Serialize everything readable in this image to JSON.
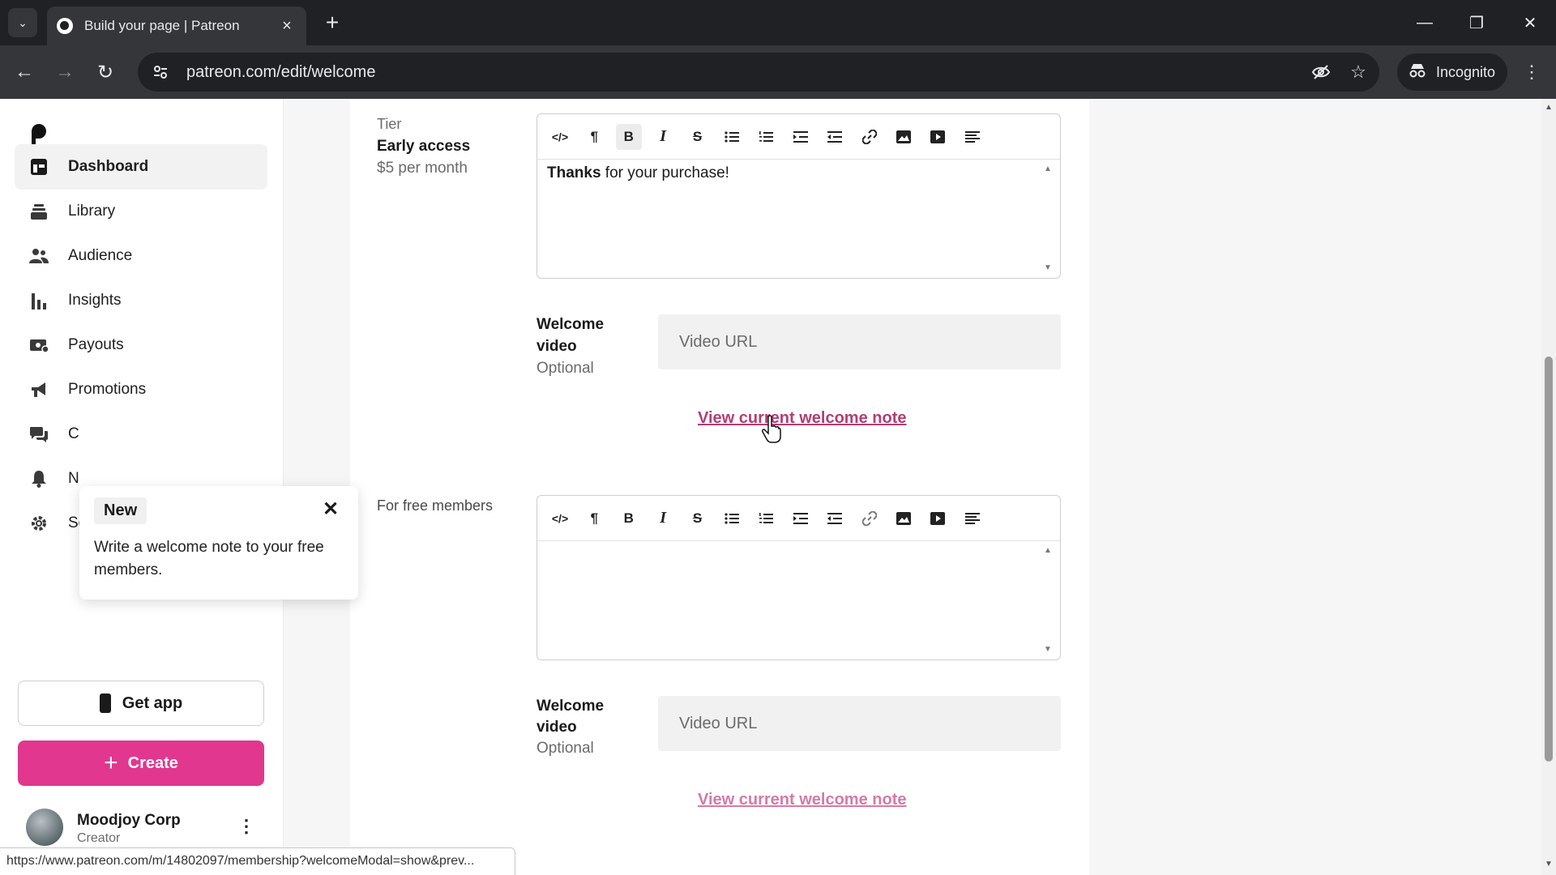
{
  "browser": {
    "tab_title": "Build your page | Patreon",
    "url": "patreon.com/edit/welcome",
    "incognito_label": "Incognito",
    "status_url": "https://www.patreon.com/m/14802097/membership?welcomeModal=show&prev..."
  },
  "sidebar": {
    "items": [
      {
        "label": "Dashboard",
        "icon": "dashboard-icon"
      },
      {
        "label": "Library",
        "icon": "library-icon"
      },
      {
        "label": "Audience",
        "icon": "audience-icon"
      },
      {
        "label": "Insights",
        "icon": "insights-icon"
      },
      {
        "label": "Payouts",
        "icon": "payouts-icon"
      },
      {
        "label": "Promotions",
        "icon": "promotions-icon"
      },
      {
        "label": "C",
        "icon": "chats-icon"
      },
      {
        "label": "N",
        "icon": "notifications-icon"
      },
      {
        "label": "Settings",
        "icon": "settings-icon"
      }
    ],
    "get_app_label": "Get app",
    "create_label": "Create",
    "profile": {
      "name": "Moodjoy Corp",
      "role": "Creator"
    }
  },
  "popover": {
    "badge": "New",
    "text": "Write a welcome note to your free members."
  },
  "tier_section": {
    "tier_label": "Tier",
    "tier_name": "Early access",
    "tier_price": "$5 per month",
    "editor_bold_text": "Thanks",
    "editor_text": " for your purchase!",
    "video_label_line1": "Welcome",
    "video_label_line2": "video",
    "video_optional": "Optional",
    "video_placeholder": "Video URL",
    "view_link": "View current welcome note"
  },
  "free_section": {
    "label": "For free members",
    "video_label_line1": "Welcome",
    "video_label_line2": "video",
    "video_optional": "Optional",
    "video_placeholder": "Video URL",
    "view_link": "View current welcome note"
  },
  "colors": {
    "brand_pink": "#e1378e",
    "link": "#b13e74"
  }
}
